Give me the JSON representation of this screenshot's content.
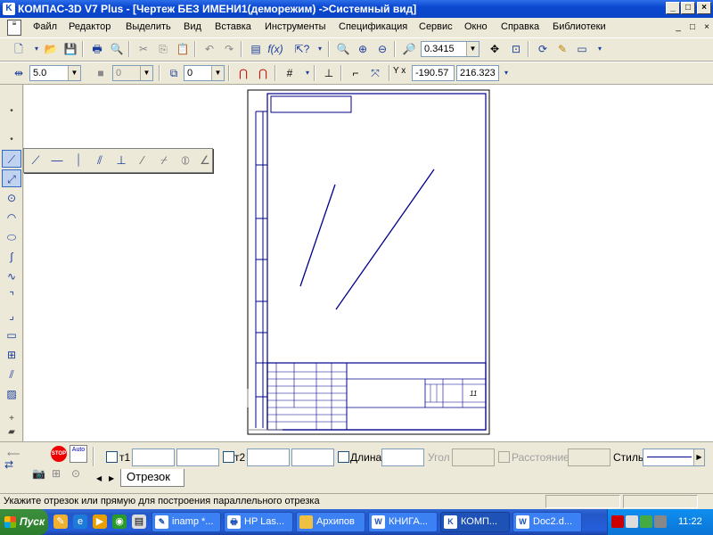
{
  "window": {
    "title": "КОМПАС-3D V7 Plus - [Чертеж БЕЗ ИМЕНИ1(деморежим) ->Системный вид]",
    "minimize": "_",
    "maximize": "□",
    "close": "×"
  },
  "menu": {
    "items": [
      "Файл",
      "Редактор",
      "Выделить",
      "Вид",
      "Вставка",
      "Инструменты",
      "Спецификация",
      "Сервис",
      "Окно",
      "Справка",
      "Библиотеки"
    ],
    "mdi_min": "_",
    "mdi_max": "□",
    "mdi_close": "×"
  },
  "toolbar1": {
    "zoom_value": "0.3415"
  },
  "toolbar2": {
    "step_value": "5.0",
    "disabled_value": "0",
    "layer_value": "0",
    "coord_label": "Y x",
    "coord_x": "-190.57",
    "coord_y": "216.323"
  },
  "propbar": {
    "t1_label": "т1",
    "t2_label": "т2",
    "length_label": "Длина",
    "angle_label": "Угол",
    "distance_label": "Расстояние",
    "style_label": "Стиль",
    "tab_label": "Отрезок",
    "stop_label": "STOP",
    "auto_label": "Auto"
  },
  "status": {
    "text": "Укажите отрезок или прямую для построения параллельного отрезка"
  },
  "taskbar": {
    "start_label": "Пуск",
    "tasks": [
      "inamp *...",
      "HP Las...",
      "Архипов",
      "КНИГА...",
      "КОМП...",
      "Doc2.d..."
    ],
    "clock": "11:22"
  },
  "drawing": {
    "title_block_number": "11"
  }
}
